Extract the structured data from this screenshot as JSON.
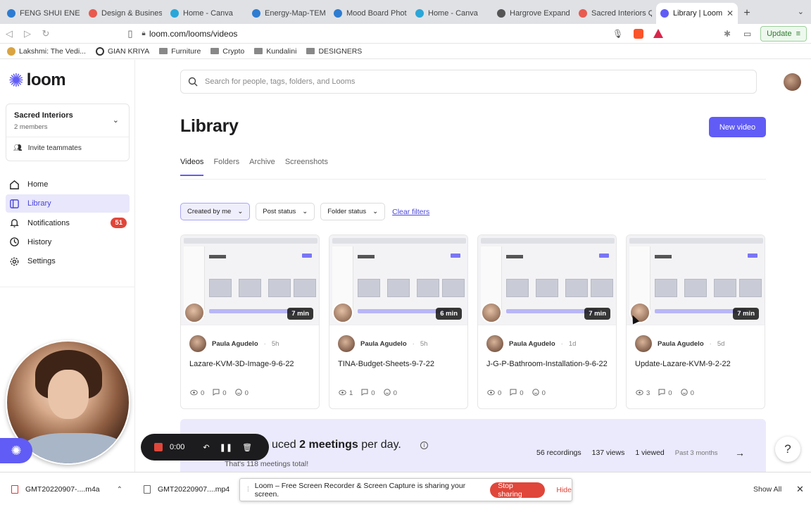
{
  "browser": {
    "tabs": [
      {
        "label": "FENG SHUI ENERG",
        "color": "#2d7cd1",
        "active": false
      },
      {
        "label": "Design & Business",
        "color": "#e85a4f",
        "active": false
      },
      {
        "label": "Home - Canva",
        "color": "#2aa6d8",
        "active": false
      },
      {
        "label": "Energy-Map-TEMP",
        "color": "#2d7cd1",
        "active": false
      },
      {
        "label": "Mood Board Photo",
        "color": "#2d7cd1",
        "active": false
      },
      {
        "label": "Home - Canva",
        "color": "#2aa6d8",
        "active": false
      },
      {
        "label": "Hargrove Expandab",
        "color": "#555555",
        "active": false
      },
      {
        "label": "Sacred Interiors Qu",
        "color": "#e85a4f",
        "active": false
      },
      {
        "label": "Library | Loom",
        "color": "#615cf5",
        "active": true
      }
    ],
    "url": "loom.com/looms/videos",
    "update_label": "Update",
    "bookmarks": [
      {
        "label": "Lakshmi: The Vedi...",
        "icon": "lotus-icon"
      },
      {
        "label": "GIAN KRIYA",
        "icon": "globe-icon"
      },
      {
        "label": "Furniture",
        "icon": "folder-icon"
      },
      {
        "label": "Crypto",
        "icon": "folder-icon"
      },
      {
        "label": "Kundalini",
        "icon": "folder-icon"
      },
      {
        "label": "DESIGNERS",
        "icon": "folder-icon"
      }
    ]
  },
  "sidebar": {
    "logo_text": "loom",
    "workspace": {
      "name": "Sacred Interiors",
      "members": "2 members"
    },
    "invite_label": "Invite teammates",
    "nav": [
      {
        "label": "Home",
        "icon": "home-icon",
        "active": false,
        "badge": ""
      },
      {
        "label": "Library",
        "icon": "library-icon",
        "active": true,
        "badge": ""
      },
      {
        "label": "Notifications",
        "icon": "bell-icon",
        "active": false,
        "badge": "51"
      },
      {
        "label": "History",
        "icon": "history-icon",
        "active": false,
        "badge": ""
      },
      {
        "label": "Settings",
        "icon": "gear-icon",
        "active": false,
        "badge": ""
      }
    ]
  },
  "main": {
    "search_placeholder": "Search for people, tags, folders, and Looms",
    "title": "Library",
    "new_video_label": "New video",
    "tabs": [
      "Videos",
      "Folders",
      "Archive",
      "Screenshots"
    ],
    "active_tab": "Videos",
    "filters": [
      {
        "label": "Created by me",
        "active": true
      },
      {
        "label": "Post status",
        "active": false
      },
      {
        "label": "Folder status",
        "active": false
      }
    ],
    "clear_filters_label": "Clear filters",
    "videos": [
      {
        "title": "Lazare-KVM-3D-Image-9-6-22",
        "author": "Paula Agudelo",
        "age": "5h",
        "duration": "7 min",
        "views": "0",
        "comments": "0",
        "reactions": "0"
      },
      {
        "title": "TINA-Budget-Sheets-9-7-22",
        "author": "Paula Agudelo",
        "age": "5h",
        "duration": "6 min",
        "views": "1",
        "comments": "0",
        "reactions": "0"
      },
      {
        "title": "J-G-P-Bathroom-Installation-9-6-22",
        "author": "Paula Agudelo",
        "age": "1d",
        "duration": "7 min",
        "views": "0",
        "comments": "0",
        "reactions": "0"
      },
      {
        "title": "Update-Lazare-KVM-9-2-22",
        "author": "Paula Agudelo",
        "age": "5d",
        "duration": "7 min",
        "views": "3",
        "comments": "0",
        "reactions": "0"
      }
    ],
    "banner": {
      "title_prefix": "uced",
      "title_bold": "2 meetings",
      "title_suffix": "per day.",
      "subtitle": "That's 118 meetings total!",
      "recordings": "56 recordings",
      "views": "137 views",
      "viewed": "1 viewed",
      "period": "Past 3 months"
    }
  },
  "recorder": {
    "time": "0:00"
  },
  "shelf": {
    "downloads": [
      "GMT20220907-....m4a",
      "GMT20220907....mp4"
    ],
    "show_all": "Show All",
    "sharing_text": "Loom – Free Screen Recorder & Screen Capture is sharing your screen.",
    "stop_sharing": "Stop sharing",
    "hide": "Hide"
  },
  "colors": {
    "accent": "#615cf5",
    "danger": "#e0463a",
    "active_bg": "#e8e7fb"
  }
}
